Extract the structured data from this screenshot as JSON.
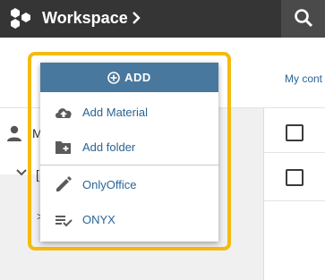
{
  "header": {
    "title": "Workspace",
    "logo_icon": "hexagon-cluster-logo",
    "breadcrumb_chevron_icon": "chevron-right-icon",
    "search_icon": "search-icon"
  },
  "subbar": {
    "my_content_label": "My cont"
  },
  "sidebar": {
    "user_item_label": "M",
    "folder_item_label": "[",
    "collapsed_marker": ">"
  },
  "add_menu": {
    "add_button_label": "ADD",
    "items": [
      {
        "label": "Add Material",
        "icon": "cloud-upload-icon"
      },
      {
        "label": "Add folder",
        "icon": "folder-plus-icon"
      },
      {
        "label": "OnlyOffice",
        "icon": "pencil-icon"
      },
      {
        "label": "ONYX",
        "icon": "list-check-icon"
      }
    ]
  },
  "colors": {
    "topbar": "#353535",
    "add_button": "#49789e",
    "link_text": "#2a6496",
    "highlight_border": "#f4ba10",
    "icon_gray": "#5a5a5a"
  }
}
